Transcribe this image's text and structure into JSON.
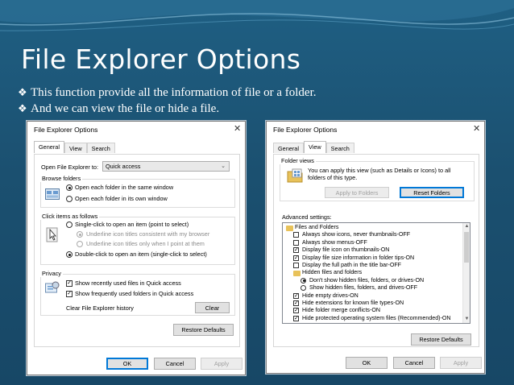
{
  "slide": {
    "title": "File Explorer Options",
    "bullets": [
      "This function provide all the information of file or a folder.",
      "And we can view the file or hide a file."
    ],
    "bullet_icon": "diamond-bullet-icon"
  },
  "dialog_general": {
    "title": "File Explorer Options",
    "tabs": [
      "General",
      "View",
      "Search"
    ],
    "active_tab": "General",
    "open_label": "Open File Explorer to:",
    "open_value": "Quick access",
    "browse": {
      "label": "Browse folders",
      "options": [
        "Open each folder in the same window",
        "Open each folder in its own window"
      ],
      "selected": 0
    },
    "click": {
      "label": "Click items as follows",
      "single": "Single-click to open an item (point to select)",
      "underline_consistent": "Underline icon titles consistent with my browser",
      "underline_point": "Underline icon titles only when I point at them",
      "double": "Double-click to open an item (single-click to select)"
    },
    "privacy": {
      "label": "Privacy",
      "recent": "Show recently used files in Quick access",
      "frequent": "Show frequently used folders in Quick access",
      "clear_label": "Clear File Explorer history",
      "clear_button": "Clear"
    },
    "restore_button": "Restore Defaults",
    "ok": "OK",
    "cancel": "Cancel",
    "apply": "Apply"
  },
  "dialog_view": {
    "title": "File Explorer Options",
    "tabs": [
      "General",
      "View",
      "Search"
    ],
    "active_tab": "View",
    "folder_views": {
      "label": "Folder views",
      "description_1": "You can apply this view (such as Details or Icons) to all",
      "description_2": "folders of this type.",
      "apply_button": "Apply to Folders",
      "reset_button": "Reset Folders"
    },
    "advanced_label": "Advanced settings:",
    "advanced_items": [
      {
        "kind": "folder",
        "label": "Files and Folders",
        "indent": 0
      },
      {
        "kind": "check",
        "checked": false,
        "label": "Always show icons, never thumbnails-OFF",
        "indent": 1
      },
      {
        "kind": "check",
        "checked": false,
        "label": "Always show menus-OFF",
        "indent": 1
      },
      {
        "kind": "check",
        "checked": true,
        "label": "Display file icon on thumbnails-ON",
        "indent": 1
      },
      {
        "kind": "check",
        "checked": true,
        "label": "Display file size information in folder tips-ON",
        "indent": 1
      },
      {
        "kind": "check",
        "checked": false,
        "label": "Display the full path in the title bar-OFF",
        "indent": 1
      },
      {
        "kind": "folder",
        "label": "Hidden files and folders",
        "indent": 1
      },
      {
        "kind": "radio",
        "checked": true,
        "label": "Don't show hidden files, folders, or drives-ON",
        "indent": 2
      },
      {
        "kind": "radio",
        "checked": false,
        "label": "Show hidden files, folders, and drives-OFF",
        "indent": 2
      },
      {
        "kind": "check",
        "checked": true,
        "label": "Hide empty drives-ON",
        "indent": 1
      },
      {
        "kind": "check",
        "checked": true,
        "label": "Hide extensions for known file types-ON",
        "indent": 1
      },
      {
        "kind": "check",
        "checked": true,
        "label": "Hide folder merge conflicts-ON",
        "indent": 1
      },
      {
        "kind": "check",
        "checked": true,
        "label": "Hide protected operating system files (Recommended)-ON",
        "indent": 1
      }
    ],
    "restore_button": "Restore Defaults",
    "ok": "OK",
    "cancel": "Cancel",
    "apply": "Apply"
  },
  "colors": {
    "background": "#1b5070",
    "wave": "#2f7aa3",
    "accent": "#0078d7",
    "folder": "#e8c25a"
  }
}
